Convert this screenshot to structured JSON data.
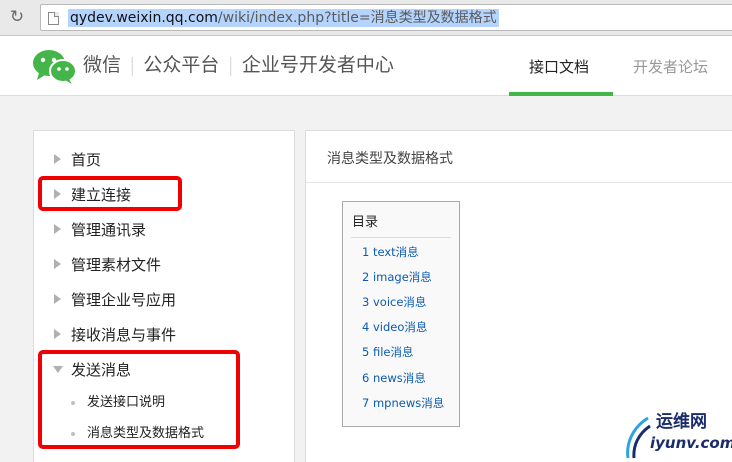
{
  "browser": {
    "url_host": "qydev.weixin.qq.com",
    "url_path": "/wiki/index.php?title=消息类型及数据格式"
  },
  "header": {
    "brand_wechat": "微信",
    "brand_platform": "公众平台",
    "brand_enterprise": "企业号开发者中心",
    "tab_docs": "接口文档",
    "tab_forum": "开发者论坛",
    "accent_color": "#44b549"
  },
  "sidebar": {
    "items": [
      {
        "label": "首页"
      },
      {
        "label": "建立连接"
      },
      {
        "label": "管理通讯录"
      },
      {
        "label": "管理素材文件"
      },
      {
        "label": "管理企业号应用"
      },
      {
        "label": "接收消息与事件"
      },
      {
        "label": "发送消息"
      }
    ],
    "subitems": [
      {
        "label": "发送接口说明"
      },
      {
        "label": "消息类型及数据格式"
      }
    ],
    "highlight_color": "#f00000"
  },
  "content": {
    "title": "消息类型及数据格式",
    "toc_title": "目录",
    "toc_items": [
      "1 text消息",
      "2 image消息",
      "3 voice消息",
      "4 video消息",
      "5 file消息",
      "6 news消息",
      "7 mpnews消息"
    ]
  },
  "watermark": {
    "line1": "运维网",
    "line2": "iyunv.com"
  }
}
